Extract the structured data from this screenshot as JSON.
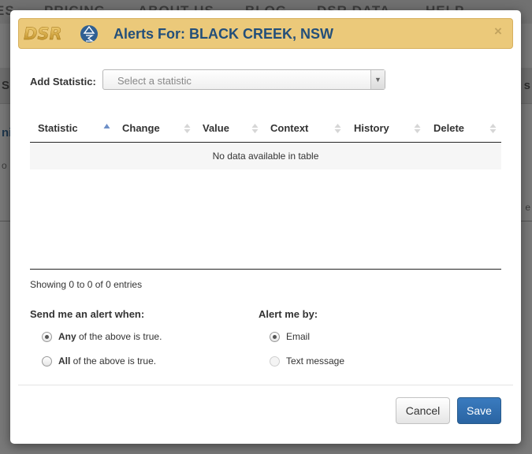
{
  "background": {
    "nav_items": [
      "ES",
      "PRICING",
      "ABOUT US",
      "BLOG",
      "DSR DATA",
      "HELP"
    ],
    "band_left": "S",
    "band_right": "s",
    "side_text": "ni",
    "side_small": "o",
    "right_small": "e"
  },
  "modal": {
    "logo_text": "DSR",
    "title": "Alerts For: BLACK CREEK, NSW",
    "close_symbol": "×",
    "add_statistic_label": "Add Statistic:",
    "select": {
      "placeholder": "Select a statistic",
      "arrow": "▼"
    },
    "table": {
      "columns": [
        "Statistic",
        "Change",
        "Value",
        "Context",
        "History",
        "Delete"
      ],
      "empty_message": "No data available in table"
    },
    "info": "Showing 0 to 0 of 0 entries",
    "send_alert": {
      "label": "Send me an alert when:",
      "options": [
        {
          "bold": "Any",
          "rest": " of the above is true.",
          "checked": true
        },
        {
          "bold": "All",
          "rest": " of the above is true.",
          "checked": false
        }
      ]
    },
    "alert_by": {
      "label": "Alert me by:",
      "options": [
        {
          "label": "Email",
          "checked": true
        },
        {
          "label": "Text message",
          "checked": false,
          "disabled": true
        }
      ]
    },
    "buttons": {
      "cancel": "Cancel",
      "save": "Save"
    }
  },
  "colors": {
    "header_bg": "#ebc97a",
    "title_color": "#234f7a",
    "primary_button": "#2a64a2",
    "sort_active": "#6d8fc7"
  }
}
